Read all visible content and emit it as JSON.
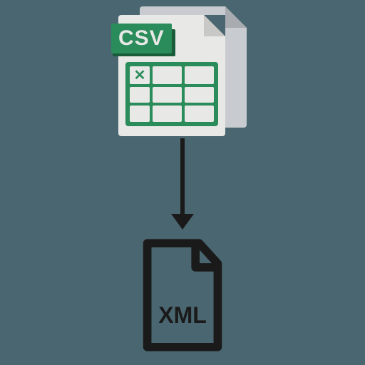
{
  "source": {
    "format_label": "CSV",
    "cell_marker": "✕"
  },
  "target": {
    "format_label": "XML"
  },
  "diagram": {
    "direction": "csv-to-xml"
  }
}
